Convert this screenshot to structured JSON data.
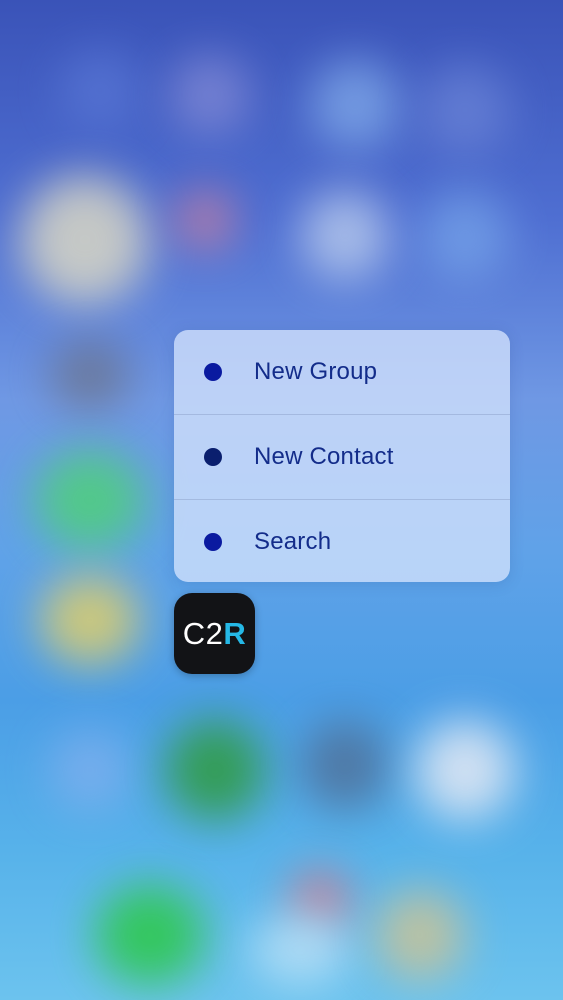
{
  "shortcut_menu": {
    "items": [
      {
        "label": "New Group",
        "dot_color": "#0a1aa0"
      },
      {
        "label": "New Contact",
        "dot_color": "#0a1f6e"
      },
      {
        "label": "Search",
        "dot_color": "#0a1aa0"
      }
    ],
    "text_color": "#132c8a"
  },
  "app_icon": {
    "text_main": "C2",
    "text_accent": "R",
    "accent_color": "#25b8e6",
    "background": "#121316"
  },
  "wallpaper": {
    "icon_name": "blurred-home-screen"
  }
}
